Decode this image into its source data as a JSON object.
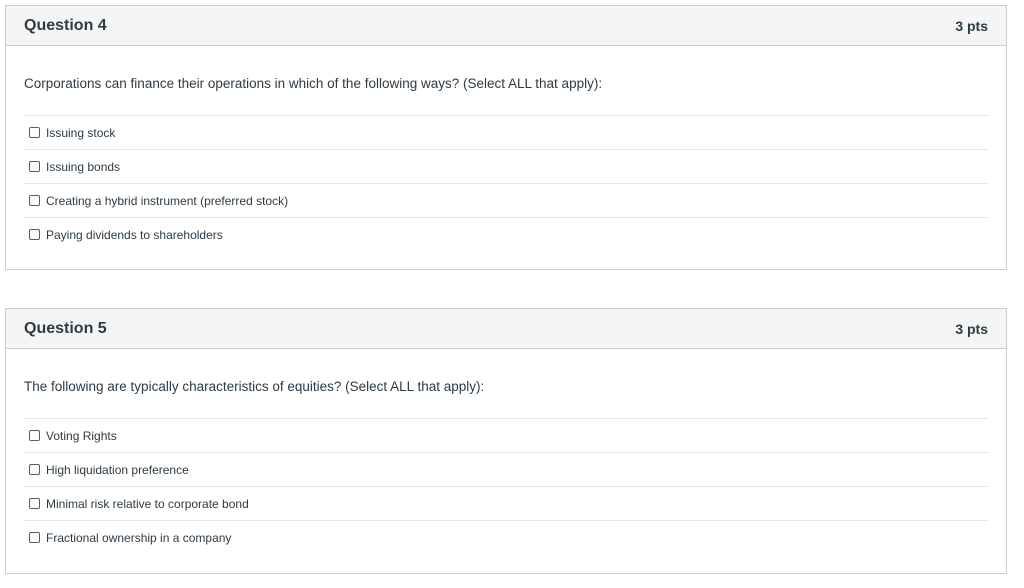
{
  "questions": [
    {
      "title": "Question 4",
      "points": "3 pts",
      "text": "Corporations can finance their operations in which of the following ways? (Select ALL that apply):",
      "answers": [
        "Issuing stock",
        "Issuing bonds",
        "Creating a hybrid instrument (preferred stock)",
        "Paying dividends to shareholders"
      ]
    },
    {
      "title": "Question 5",
      "points": "3 pts",
      "text": "The following are typically characteristics of equities? (Select ALL that apply):",
      "answers": [
        "Voting Rights",
        "High liquidation preference",
        "Minimal risk relative to corporate bond",
        "Fractional ownership in a company"
      ]
    }
  ]
}
